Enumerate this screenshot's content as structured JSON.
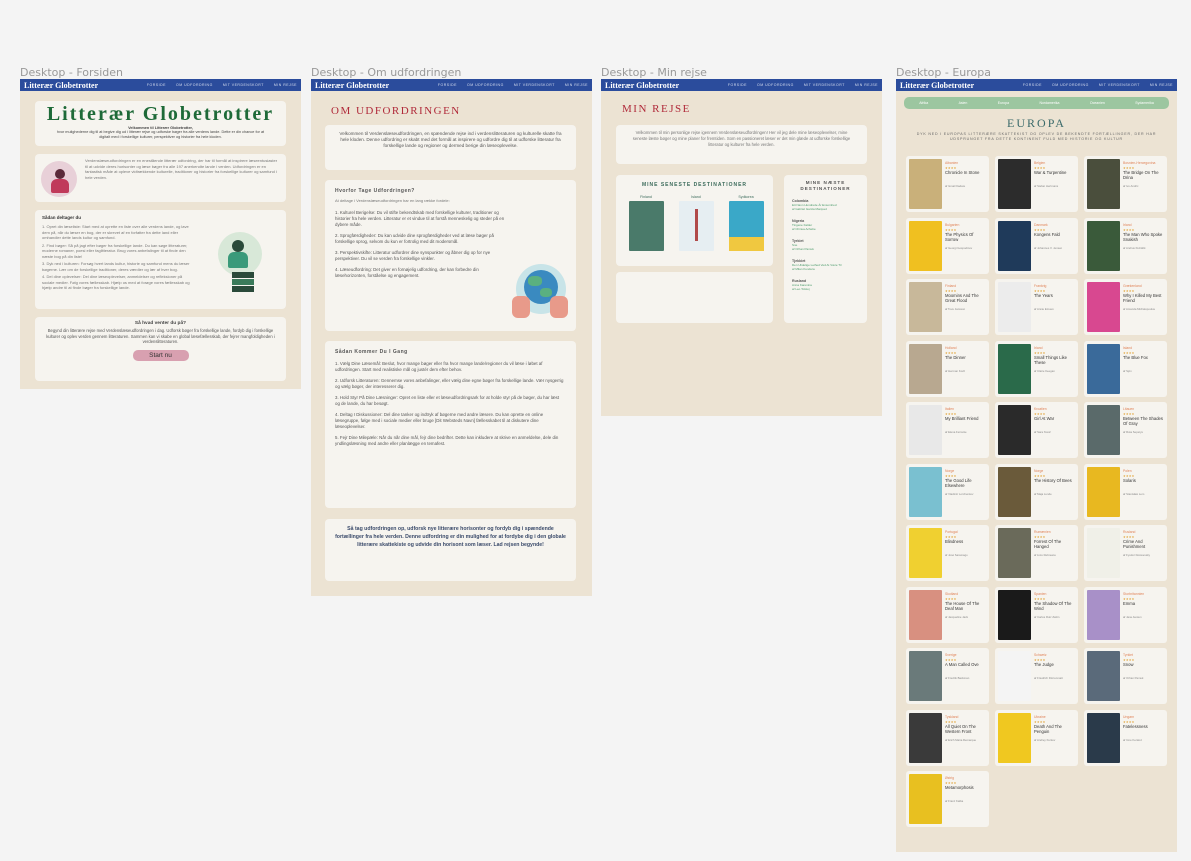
{
  "frames": {
    "forsiden": "Desktop - Forsiden",
    "om": "Desktop - Om udfordringen",
    "rejse": "Desktop - Min rejse",
    "europa": "Desktop - Europa"
  },
  "nav": {
    "logo": "Litterær Globetrotter",
    "links": [
      "FORSIDE",
      "OM UDFORDRING",
      "MIT VERDENSKORT",
      "MIN REJSE"
    ]
  },
  "forsiden": {
    "title": "Litterær Globetrotter",
    "intro1": "Velkommen til Litterær Globetrotter,",
    "intro2": "hvor mulighederne dig til at begive dig ud i litterær rejse og udforske bøger fra alle verdens lande. Dette er din chance for at",
    "intro3": "digitalt med i forskellige kulturer, perspektiver og historier fra hele kloden.",
    "desc": "Verdenslæseudfordringen er en enestående litterær udfordring, der har til formål at inspirere læseentusiaster til at udvide deres horisonter og læse bøger fra alle 197 anerkendte lande i verden. Udfordringen er en fantastisk måde at opleve vidtrækkende kulturelle, traditioner og historier fra forskellige kulturer og samfund i hele verden.",
    "steps_title": "Sådan deltager du",
    "steps": [
      "Opret din læseliste: Start med at oprette en liste over alle verdens lande, og lave dem på, når du læser en bog, der er skrevet af en forfatter fra dette land eller omhandler dette lands kultur og samfund.",
      "Find bøger: Så på jagt efter bøger fra forskellige lande. Du kan søge litteraturer, moderne romaner, poesi eller faglitteratur. Brug vores anbefalinger til at finde den næste bog på din liste!",
      "Dyk ned i kulturen: Forsøg hvert lands kultur, historie og samfund mens du læser bøgerne. Lær om de forskellige traditioner, deres værdier og lær af hver bog.",
      "Del dine oplevelser: Del dine læseoplevelser, anmeldelser og refleksioner på sociale medier. Følg vores fællesskab. Hjælp os med at forøge vores fællesskab og hjælp andre til at finde bøger fra forskellige lande."
    ],
    "cta_title": "Så hvad venter du på?",
    "cta_text": "Begynd din litterære rejse med Verdenslæseudfordringen i dag. Udforsk bøger fra forskellige lande, fordyb dig i forskellige kulturer og oplev verden gennem litteraturen. Sammen kan vi skabe en global læsefællesskab, der fejrer mangfoldigheden i verdenslitteraturen.",
    "cta_button": "Start nu"
  },
  "om": {
    "title": "OM UDFORDRINGEN",
    "intro": "Velkommen til Verdenslæseudfordringen, en spændende rejse ind i verdenslitteraturen og kulturelle skatte fra hele kloden. Denne udfordring er skabt med det formål at inspirere og udfordre dig til at udforske litteratur fra forskellige lande og regioner og dermed berige din læseoplevelse.",
    "why_title": "Hvorfor Tage Udfordringen?",
    "why_intro": "At deltage i Verdenslæseudfordringen har en lang række fordele:",
    "why_items": [
      "Kulturel Berigelse: Du vil stifte bekendtskab med forskellige kulturer, traditioner og historier fra hele verden. Litteratur er et vindue til at forstå menneskelig og steder på en dybere måde.",
      "Sprogfærdigheder: Du kan udvide dine sprogfærdigheder ved at læse bøger på forskellige sprog, selvom du kun er fortrolig med dit modersmål.",
      "Perspektivskifte: Litteratur udfordrer dine synspunkter og åbner dig op for nye perspektiver. Du vil se verden fra forskellige vinkler.",
      "Læseudfordring: Det giver en fornøjelig udfordring, der kan forbedre din læsehorizonten, forståelse og engagement."
    ],
    "how_title": "Sådan Kommer Du I Gang",
    "how_items": [
      "Vælg Dine Læsemål: Beslut, hvor mange bøger eller fra hvor mange lande/regioner du vil læse i løbet af udfordringen. Start med realistiske mål og justér dem efter behov.",
      "Udforsk Litteraturen: Gennemse vores anbefalinger, eller vælg dine egne bøger fra forskellige lande. Vær nysgerrig og vælg bøger, der interesserer dig.",
      "Hold Styr På Dine Læsninger: Opret en liste eller et læseudfordringsark for at holde styr på de bøger, du har læst og de lande, du har besøgt.",
      "Deltag I Diskussioner: Del dine tanker og indtryk af bøgerne med andre læsere. Du kan oprette en online læsegruppe, følge med i sociale medier eller bruge [Dit Websteds Navn] fællesskabet til at diskutere dine læseoplevelser.",
      "Fejr Dine Milepæle: Når du når dine mål, fejr dine bedrifter. Dette kan inkludere at skrive en anmeldelse, dele din yndlingslæsning med andre eller planlægge en temafest."
    ],
    "outro": "Så tag udfordringen op, udforsk nye litterære horisonter og fordyb dig i spændende fortællinger fra hele verden. Denne udfordring er din mulighed for at fordybe dig i den globale litterære skattekiste og udvide din horisont som læser. Lad rejsen begynde!"
  },
  "rejse": {
    "title": "MIN REJSE",
    "intro": "Velkommen til min personlige rejse igennem Verdenslæseudfordringen! Her vil jeg dele mine læseoplevelser, mine seneste læste bøger og mine planer for fremtiden. Som en passioneret læser er det min glæde at udforske forskellige litteratur og kulturer fra hele verden.",
    "latest_title": "MINE SENESTE DESTINATIONER",
    "latest": [
      {
        "country": "Finland",
        "color": "#4a7a6a"
      },
      {
        "country": "Island",
        "color": "#e6eef2"
      },
      {
        "country": "Sydkorea",
        "color": "#3aa8c8"
      }
    ],
    "next_title": "MINE NÆSTE DESTINATIONER",
    "next": [
      {
        "country": "Colombia",
        "book": "Ett Navn Hundrede År Ensomhed",
        "author": "af Gabriel Garcia Marquez"
      },
      {
        "country": "Nigeria",
        "book": "Tingene Falder",
        "author": "af Chinua Achebe"
      },
      {
        "country": "Tyrkiet",
        "book": "Sne",
        "author": "af Orhan Pamuk"
      },
      {
        "country": "Tjekkiet",
        "book": "Den Ulidelige Lethed Ved At Være Til",
        "author": "af Milan Kundera"
      },
      {
        "country": "Rusland",
        "book": "Anna Karenina",
        "author": "af Leo Tolstoj"
      }
    ]
  },
  "europa": {
    "tabs": [
      "Afrika",
      "Asien",
      "Europa",
      "Nordamerika",
      "Oceanien",
      "Sydamerika"
    ],
    "title": "EUROPA",
    "subtitle": "DYK NED I EUROPAS LITTERÆRE SKATTEKIST OG OPLEV DE BEKENDTE FORTÆLLINGER, DER HAR UDSPRUNGET FRA DETTE KONTINENT FULD MED HISTORIE OG KULTUR",
    "stars": "★★★★",
    "books": [
      {
        "country": "Albanien",
        "title": "Chronicle In Stone",
        "author": "af Ismail Kadare",
        "color": "#c9b07a"
      },
      {
        "country": "Belgien",
        "title": "War & Turpentine",
        "author": "af Stefan Hertmans",
        "color": "#2c2c2c"
      },
      {
        "country": "Bosnien-Hercegovina",
        "title": "The Bridge On The Drina",
        "author": "af Ivo Andric",
        "color": "#4a4e3c"
      },
      {
        "country": "Bulgarien",
        "title": "The Physics Of Sorrow",
        "author": "af Georgi Gospodinov",
        "color": "#f0c020"
      },
      {
        "country": "Danmark",
        "title": "Kongens Fald",
        "author": "af Johannes V. Jensen",
        "color": "#1f3a5a"
      },
      {
        "country": "Irland",
        "title": "The Man Who Spoke Snakish",
        "author": "af Andrus Kivirähk",
        "color": "#3a5a3a"
      },
      {
        "country": "Finland",
        "title": "Moomins And The Great Flood",
        "author": "af Tove Jansson",
        "color": "#c8b89a"
      },
      {
        "country": "Frankrig",
        "title": "The Years",
        "author": "af Annie Ernaux",
        "color": "#ececec"
      },
      {
        "country": "Grækenland",
        "title": "Why I Killed My Best Friend",
        "author": "af Amanda Michalopoulou",
        "color": "#d84890"
      },
      {
        "country": "Holland",
        "title": "The Dinner",
        "author": "af Herman Koch",
        "color": "#b8a890"
      },
      {
        "country": "Irland",
        "title": "Small Things Like These",
        "author": "af Claire Keegan",
        "color": "#2a6a4a"
      },
      {
        "country": "Island",
        "title": "The Blue Fox",
        "author": "af Sjón",
        "color": "#3a6a9a"
      },
      {
        "country": "Italien",
        "title": "My Brilliant Friend",
        "author": "af Elena Ferrante",
        "color": "#e8e8e8"
      },
      {
        "country": "Kroatien",
        "title": "Girl At War",
        "author": "af Sara Nović",
        "color": "#2a2a2a"
      },
      {
        "country": "Litauen",
        "title": "Between The Shades Of Gray",
        "author": "af Ruta Sepetys",
        "color": "#5a6a6a"
      },
      {
        "country": "Norge",
        "title": "The Good Life Elsewhere",
        "author": "af Vladimir Lorchenkov",
        "color": "#7ac0d0"
      },
      {
        "country": "Norge",
        "title": "The History Of Bees",
        "author": "af Maja Lunde",
        "color": "#6a5a3a"
      },
      {
        "country": "Polen",
        "title": "Solaris",
        "author": "af Stanisław Lem",
        "color": "#e8b820"
      },
      {
        "country": "Portugal",
        "title": "Blindness",
        "author": "af José Saramago",
        "color": "#f0d030"
      },
      {
        "country": "Rumænien",
        "title": "Forrest Of The Hanged",
        "author": "af Liviu Rebreanu",
        "color": "#6a6a5a"
      },
      {
        "country": "Rusland",
        "title": "Crime And Punishment",
        "author": "af Fyodor Dostoevsky",
        "color": "#f0f0e8"
      },
      {
        "country": "Skotland",
        "title": "The House Of The Deaf Man",
        "author": "af Jacqueline Jack",
        "color": "#d89080"
      },
      {
        "country": "Spanien",
        "title": "The Shadow Of The Wind",
        "author": "af Carlos Ruiz Zafón",
        "color": "#1a1a1a"
      },
      {
        "country": "Storbritannien",
        "title": "Emma",
        "author": "af Jane Austen",
        "color": "#a890c8"
      },
      {
        "country": "Sverige",
        "title": "A Man Called Ove",
        "author": "af Fredrik Backman",
        "color": "#6a7a7a"
      },
      {
        "country": "Schweiz",
        "title": "The Judge",
        "author": "af Friedrich Dürrenmatt",
        "color": "#f4f4f4"
      },
      {
        "country": "Tyrkiet",
        "title": "Snow",
        "author": "af Orhan Pamuk",
        "color": "#5a6a7a"
      },
      {
        "country": "Tyskland",
        "title": "All Quiet On The Western Front",
        "author": "af Erich Maria Remarque",
        "color": "#3a3a3a"
      },
      {
        "country": "Ukraine",
        "title": "Death And The Penguin",
        "author": "af Andrey Kurkov",
        "color": "#f0c820"
      },
      {
        "country": "Ungarn",
        "title": "Fatelessness",
        "author": "af Imre Kertész",
        "color": "#2a3a4a"
      },
      {
        "country": "Østrig",
        "title": "Metamorphosis",
        "author": "af Franz Kafka",
        "color": "#e8c020"
      }
    ]
  }
}
